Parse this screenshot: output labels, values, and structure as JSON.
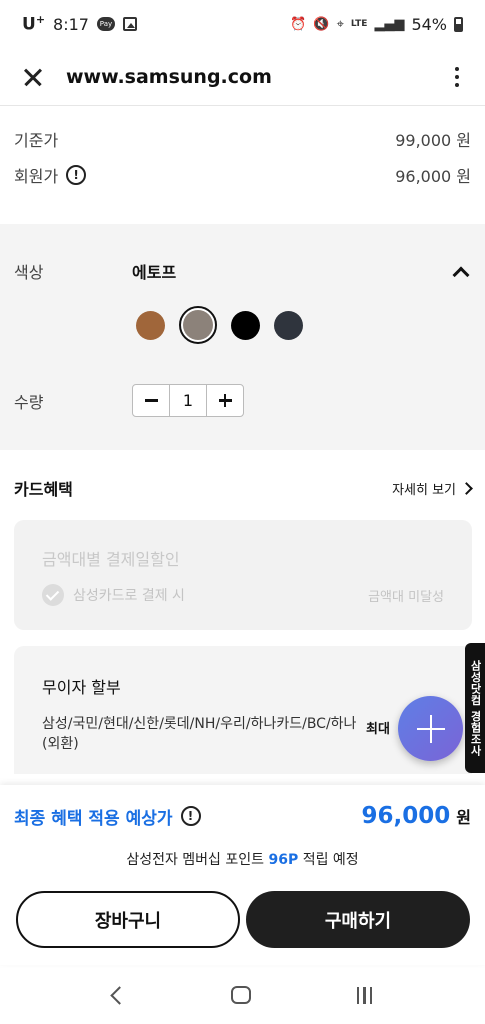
{
  "status_bar": {
    "carrier": "U",
    "carrier_suffix": "+",
    "time": "8:17",
    "pay_label": "Pay",
    "network": "LTE",
    "battery": "54%"
  },
  "browser": {
    "url": "www.samsung.com"
  },
  "prices": {
    "base_label": "기준가",
    "base_value": "99,000 원",
    "member_label": "회원가",
    "member_value": "96,000 원"
  },
  "options": {
    "color_label": "색상",
    "color_selected": "에토프",
    "swatches": [
      "#a0663a",
      "#8c827a",
      "#000000",
      "#2f343d"
    ],
    "selected_index": 1,
    "quantity_label": "수량",
    "quantity_value": "1"
  },
  "card_benefits": {
    "title": "카드혜택",
    "detail_link": "자세히 보기",
    "discount": {
      "title": "금액대별 결제일할인",
      "condition": "삼성카드로 결제 시",
      "status": "금액대 미달성"
    },
    "installment": {
      "title": "무이자 할부",
      "cards": "삼성/국민/현대/신한/롯데/NH/우리/하나카드/BC/하나(외환)",
      "max_label": "최대"
    }
  },
  "side_survey": "삼성닷컴 경험조사",
  "summary": {
    "final_label": "최종 혜택 적용 예상가",
    "final_price": "96,000",
    "final_unit": "원",
    "points_prefix": "삼성전자 멤버십 포인트",
    "points_value": "96P",
    "points_suffix": "적립 예정"
  },
  "buttons": {
    "cart": "장바구니",
    "buy": "구매하기"
  }
}
